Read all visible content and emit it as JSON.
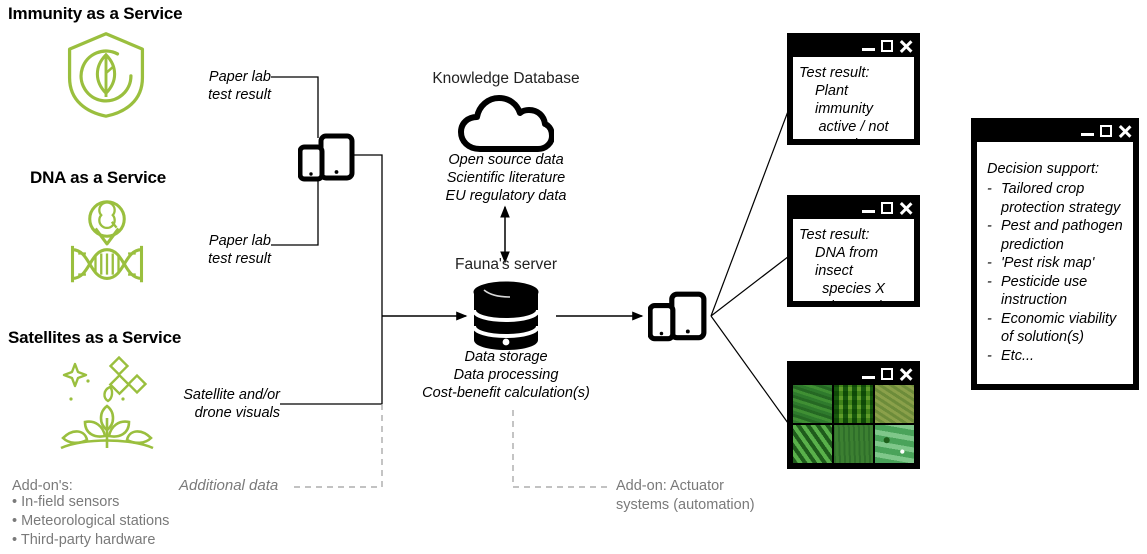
{
  "services": [
    {
      "id": "immunity",
      "title": "Immunity as a Service",
      "icon": "shield-leaf-icon",
      "flow_label_line1": "Paper lab",
      "flow_label_line2": "test result"
    },
    {
      "id": "dna",
      "title": "DNA as a Service",
      "icon": "dna-helix-icon",
      "flow_label_line1": "Paper lab",
      "flow_label_line2": "test result"
    },
    {
      "id": "satellites",
      "title": "Satellites as a Service",
      "icon": "satellite-plant-icon",
      "flow_label_line1": "Satellite and/or",
      "flow_label_line2": "drone visuals"
    }
  ],
  "devices": {
    "input_device_icon": "tablet-phone-icon",
    "output_device_icon": "tablet-phone-icon"
  },
  "knowledge_database": {
    "title": "Knowledge Database",
    "icon": "cloud-icon",
    "items": [
      "Open source data",
      "Scientific literature",
      "EU regulatory data"
    ]
  },
  "server": {
    "title": "Fauna's server",
    "icon": "database-cylinder-icon",
    "items": [
      "Data storage",
      "Data processing",
      "Cost-benefit calculation(s)"
    ]
  },
  "result_windows": [
    {
      "id": "immunity-result",
      "line1": "Test result:",
      "line2": "Plant immunity",
      "line3": "active / not active"
    },
    {
      "id": "dna-result",
      "line1": "Test result:",
      "line2": "DNA from insect",
      "line3": "species X detected"
    }
  ],
  "satellite_window": {
    "id": "satellite-imagery",
    "tiles": [
      "#2e7a2c",
      "#4f9b2c",
      "#8aa04a",
      "#3f8f35",
      "#2f6f2a",
      "#4aa35a"
    ]
  },
  "decision_window": {
    "title": "Decision support:",
    "bullet_marker": "-",
    "items": [
      "Tailored crop protection strategy",
      "Pest and pathogen prediction",
      "'Pest risk map'",
      "Pesticide use instruction",
      "Economic viability of solution(s)",
      "Etc..."
    ]
  },
  "addons": {
    "heading": "Add-on's:",
    "items": [
      "• In-field sensors",
      "• Meteorological stations",
      "• Third-party hardware"
    ],
    "additional_data_label": "Additional data",
    "actuator_label_line1": "Add-on: Actuator",
    "actuator_label_line2": "systems (automation)"
  },
  "window_controls": {
    "minimize": "minimize-icon",
    "maximize": "maximize-icon",
    "close": "close-icon"
  },
  "colors": {
    "green": "#9ABF3E",
    "black": "#000000",
    "gray_text": "#7a7a7a"
  }
}
